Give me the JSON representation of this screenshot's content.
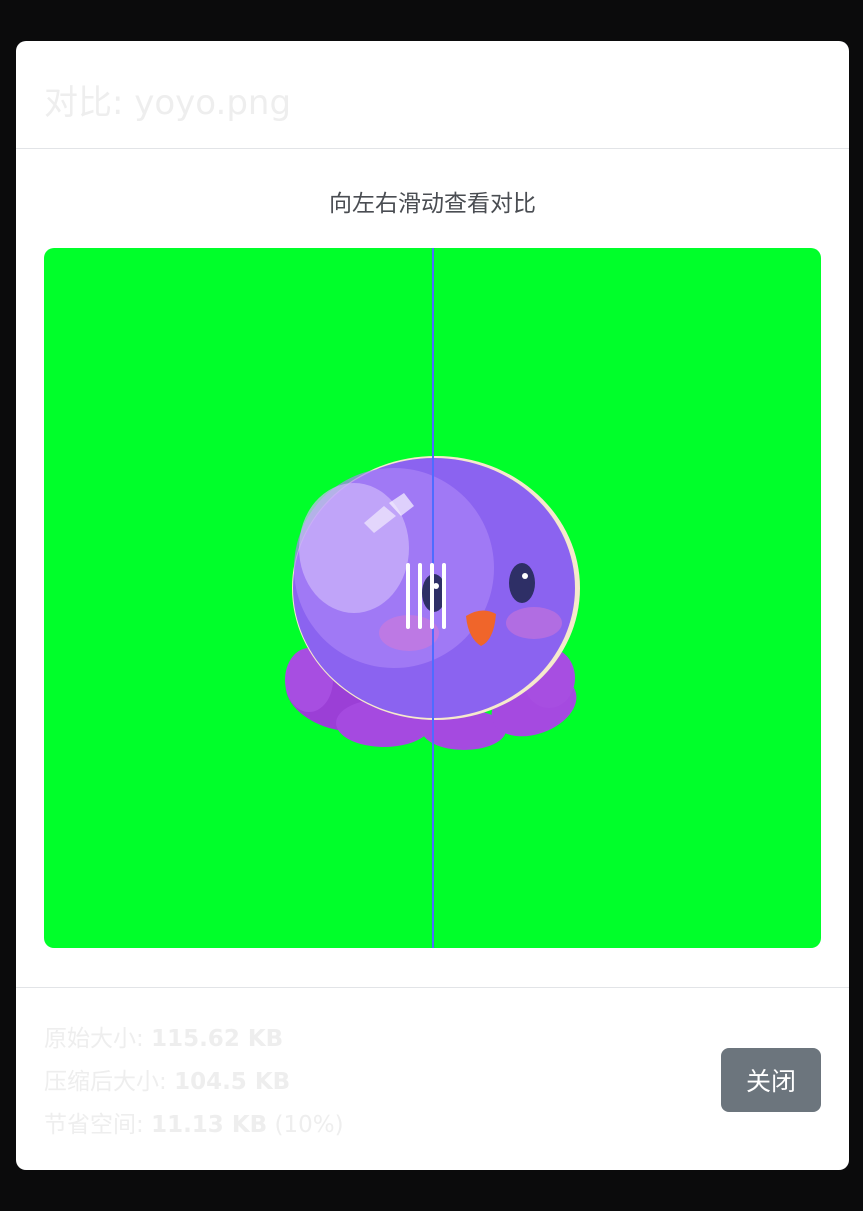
{
  "modal": {
    "title": "对比: yoyo.png",
    "hint": "向左右滑动查看对比",
    "compare_position": 0.5,
    "image_alt": "yoyo octopus mascot",
    "close_label": "关闭"
  },
  "stats": {
    "original_label": "原始大小: ",
    "original_value": "115.62 KB",
    "compressed_label": "压缩后大小: ",
    "compressed_value": "104.5 KB",
    "saved_label": "节省空间: ",
    "saved_value": "11.13 KB",
    "saved_percent": " (10%)"
  },
  "colors": {
    "image_background": "#00ff2a",
    "divider": "#4f6cff",
    "close_button": "#6c757d"
  }
}
